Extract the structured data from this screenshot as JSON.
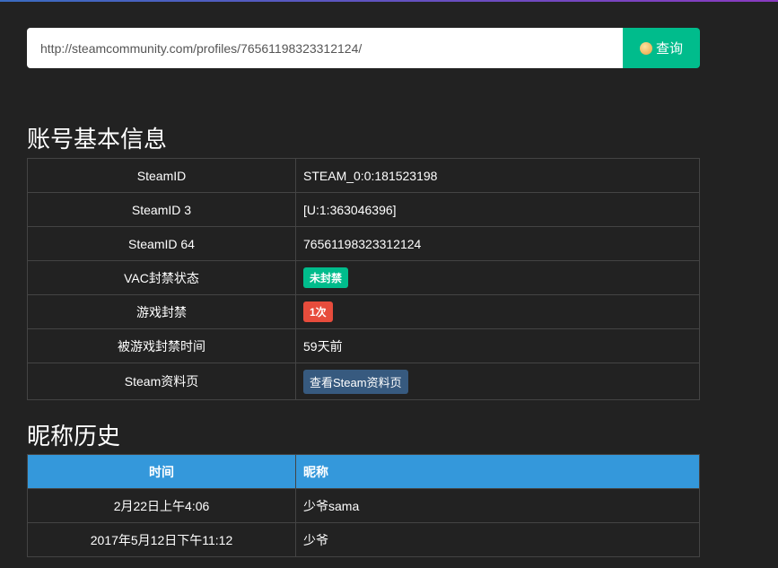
{
  "search": {
    "value": "http://steamcommunity.com/profiles/76561198323312124/",
    "button": "查询"
  },
  "basic": {
    "title": "账号基本信息",
    "rows": [
      {
        "label": "SteamID",
        "value": "STEAM_0:0:181523198"
      },
      {
        "label": "SteamID 3",
        "value": "[U:1:363046396]"
      },
      {
        "label": "SteamID 64",
        "value": "76561198323312124"
      },
      {
        "label": "VAC封禁状态",
        "value": "未封禁"
      },
      {
        "label": "游戏封禁",
        "value": "1次"
      },
      {
        "label": "被游戏封禁时间",
        "value": "59天前"
      },
      {
        "label": "Steam资料页",
        "value": "查看Steam资料页"
      }
    ]
  },
  "history": {
    "title": "昵称历史",
    "headers": [
      "时间",
      "昵称"
    ],
    "rows": [
      {
        "time": "2月22日上午4:06",
        "name": "少爷sama"
      },
      {
        "time": "2017年5月12日下午11:12",
        "name": "少爷"
      }
    ]
  },
  "colors": {
    "success": "#00bc8c",
    "danger": "#e74c3c",
    "primary": "#375a7f",
    "info": "#3498db"
  }
}
